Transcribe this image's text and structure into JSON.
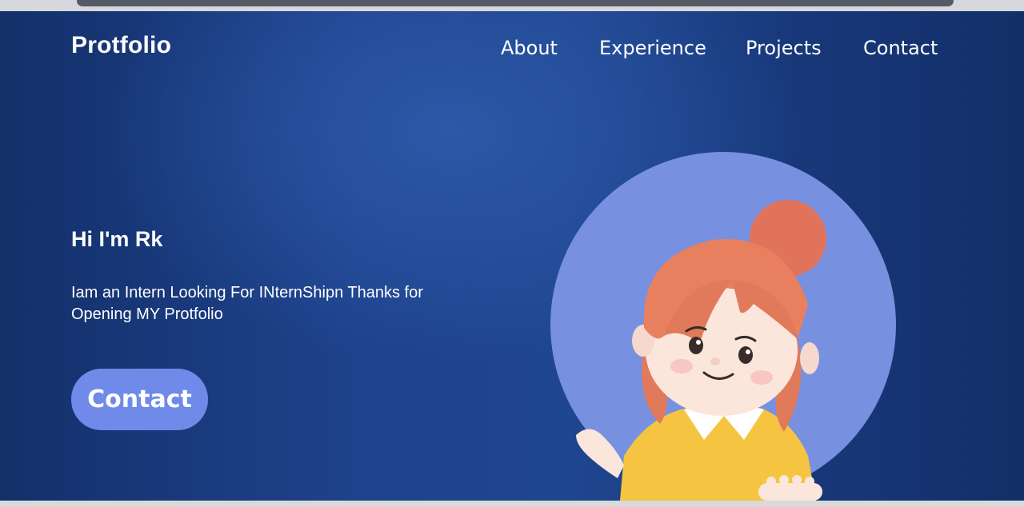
{
  "header": {
    "logo": "Protfolio",
    "nav": {
      "about": "About",
      "experience": "Experience",
      "projects": "Projects",
      "contact": "Contact"
    }
  },
  "hero": {
    "title": "Hi I'm Rk",
    "description": "Iam an Intern Looking For INternShipn Thanks for Opening MY Protfolio",
    "cta_label": "Contact"
  },
  "colors": {
    "background": "#1f4690",
    "accent": "#6f8ae8",
    "avatar_circle": "#7890e0"
  },
  "icons": {
    "avatar": "avatar-girl-illustration"
  }
}
